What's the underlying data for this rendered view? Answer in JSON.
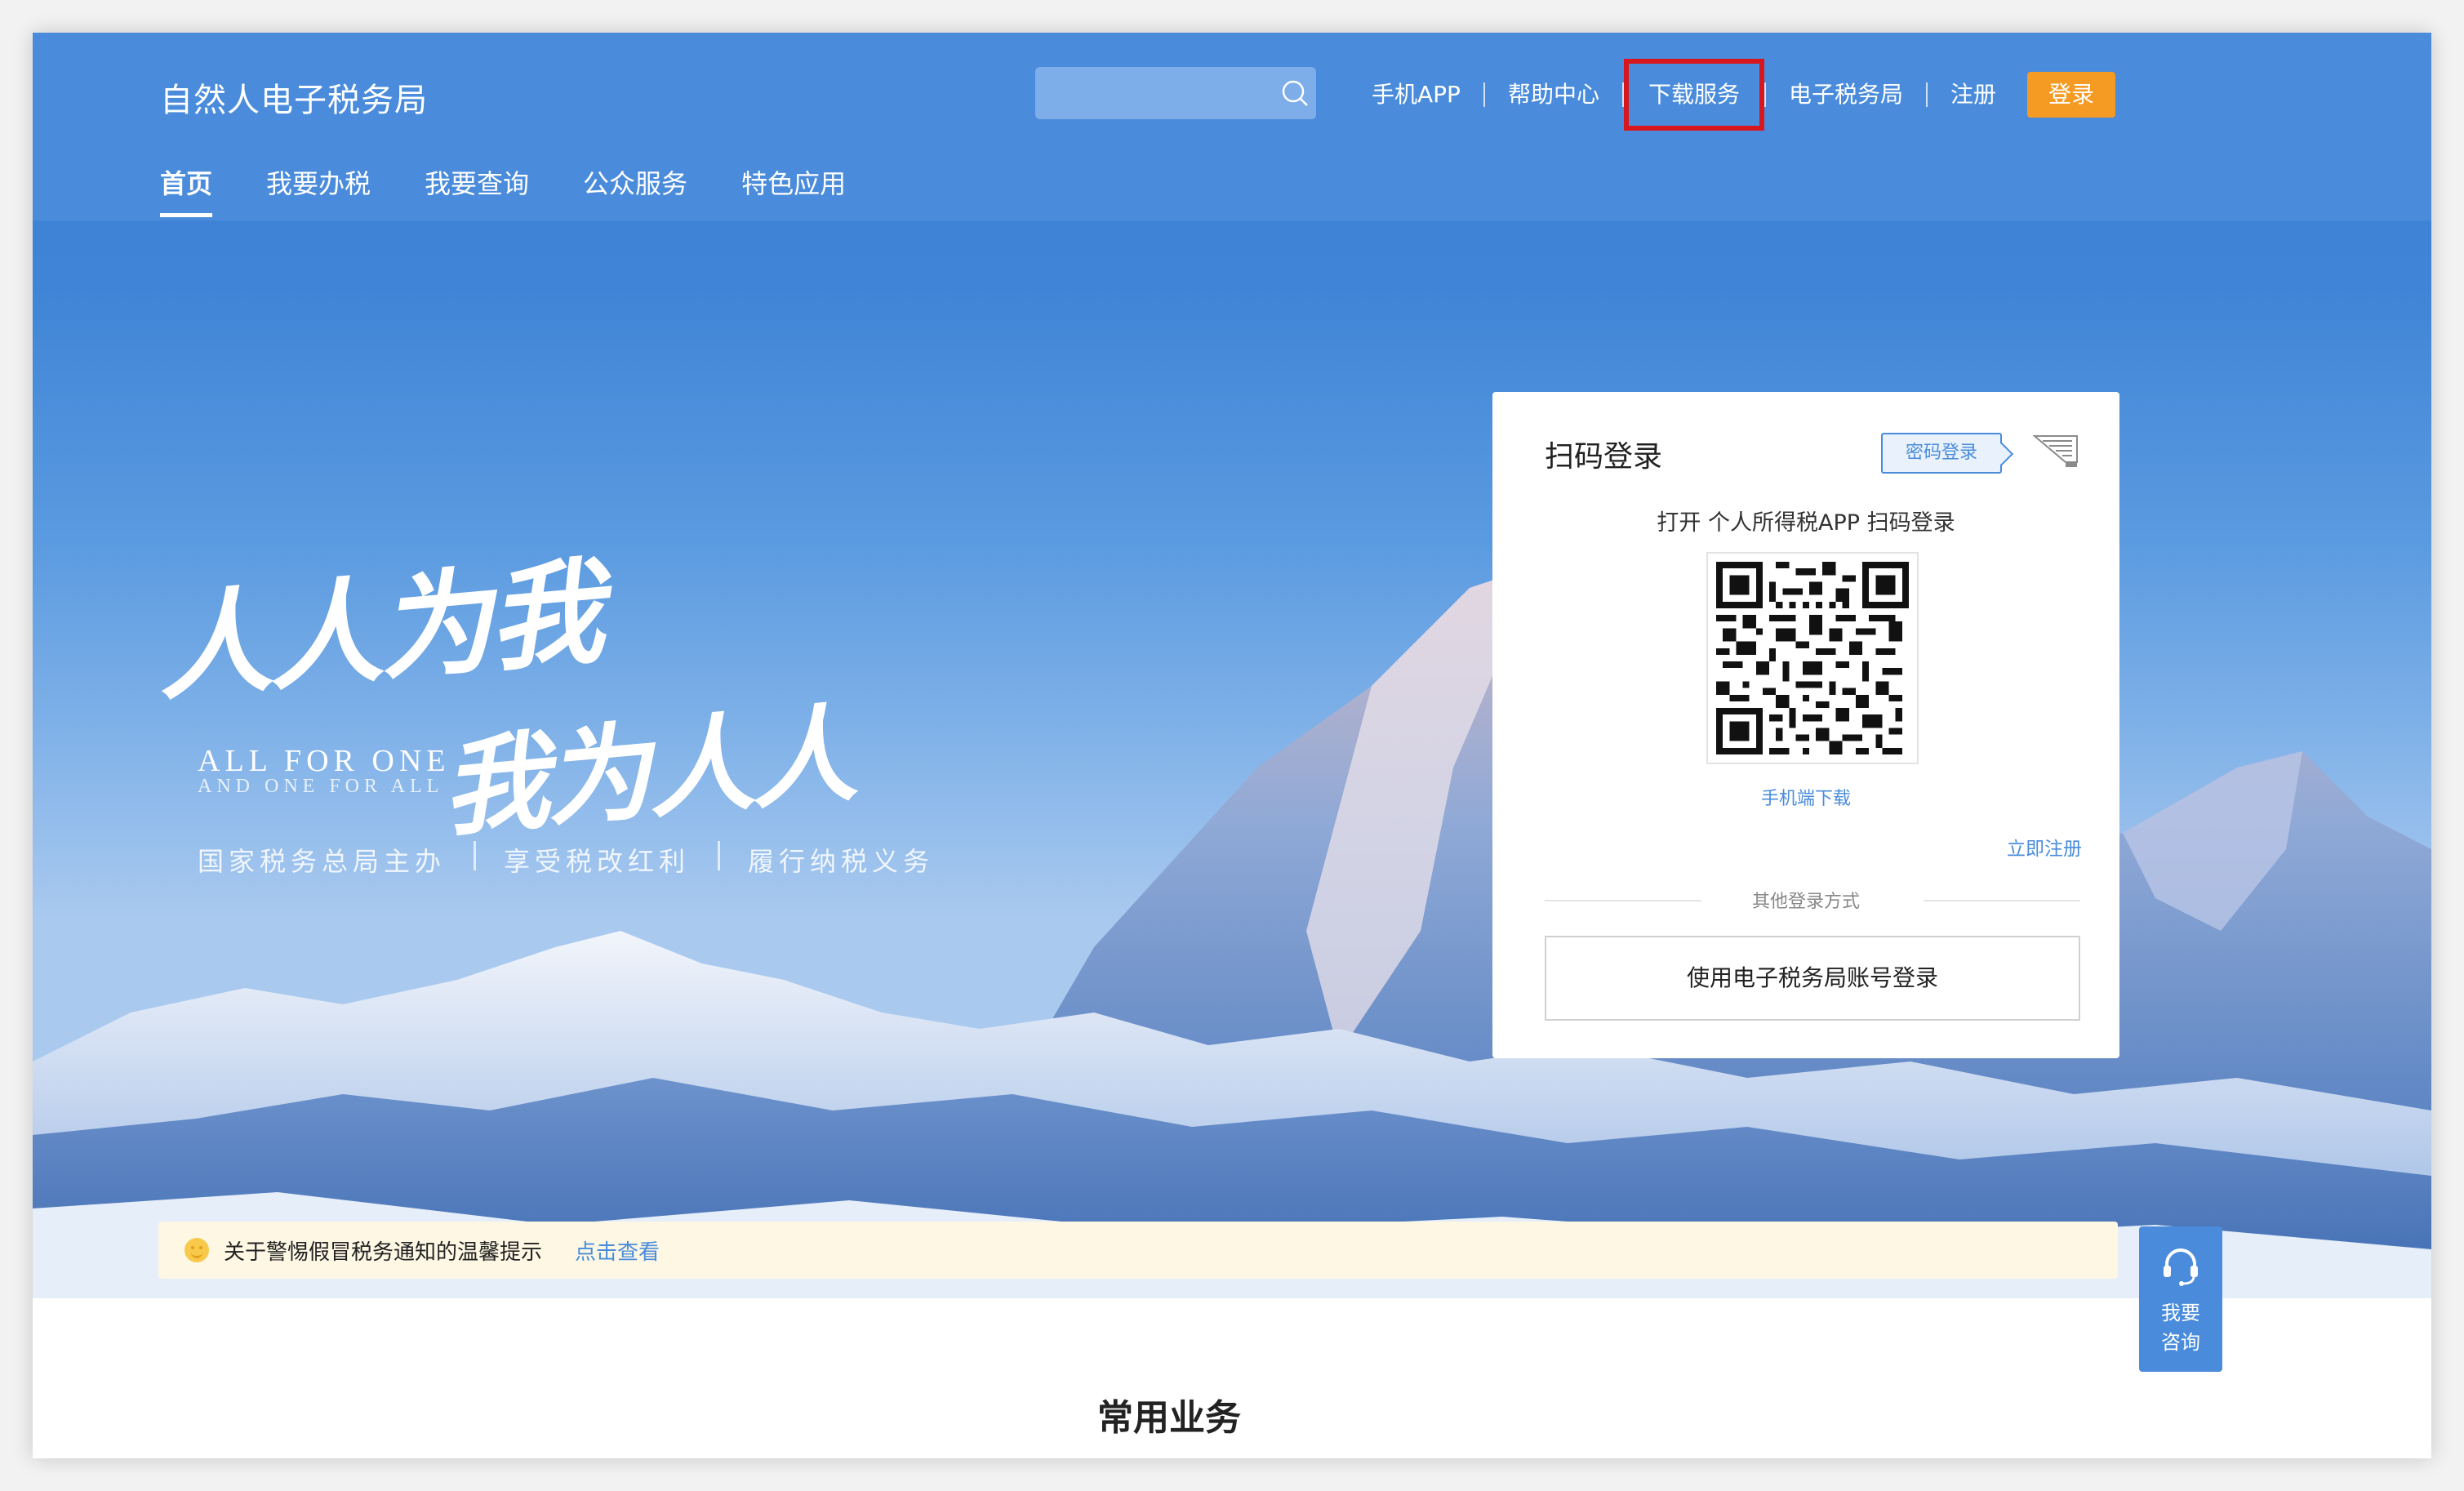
{
  "header": {
    "site_title": "自然人电子税务局",
    "search_placeholder": "",
    "top_links": [
      "手机APP",
      "帮助中心",
      "下载服务",
      "电子税务局",
      "注册"
    ],
    "login_label": "登录",
    "main_tabs": [
      "首页",
      "我要办税",
      "我要查询",
      "公众服务",
      "特色应用"
    ]
  },
  "hero": {
    "slogan_line1": "人人为我",
    "slogan_line2": "我为人人",
    "english_line1": "ALL FOR ONE",
    "english_line2": "AND ONE FOR ALL",
    "sub_items": [
      "国家税务总局主办",
      "享受税改红利",
      "履行纳税义务"
    ]
  },
  "login_card": {
    "title": "扫码登录",
    "password_login_label": "密码登录",
    "hint": "打开 个人所得税APP 扫码登录",
    "app_download": "手机端下载",
    "register_now": "立即注册",
    "other_methods": "其他登录方式",
    "account_login": "使用电子税务局账号登录"
  },
  "notice": {
    "text": "关于警惕假冒税务通知的温馨提示",
    "link": "点击查看"
  },
  "consult": {
    "line1": "我要",
    "line2": "咨询"
  },
  "section": {
    "title": "常用业务"
  },
  "colors": {
    "primary": "#4a8cdb",
    "login_button": "#f59a23",
    "highlight_border": "#d8161d",
    "notice_bg": "#fdf7e4"
  }
}
